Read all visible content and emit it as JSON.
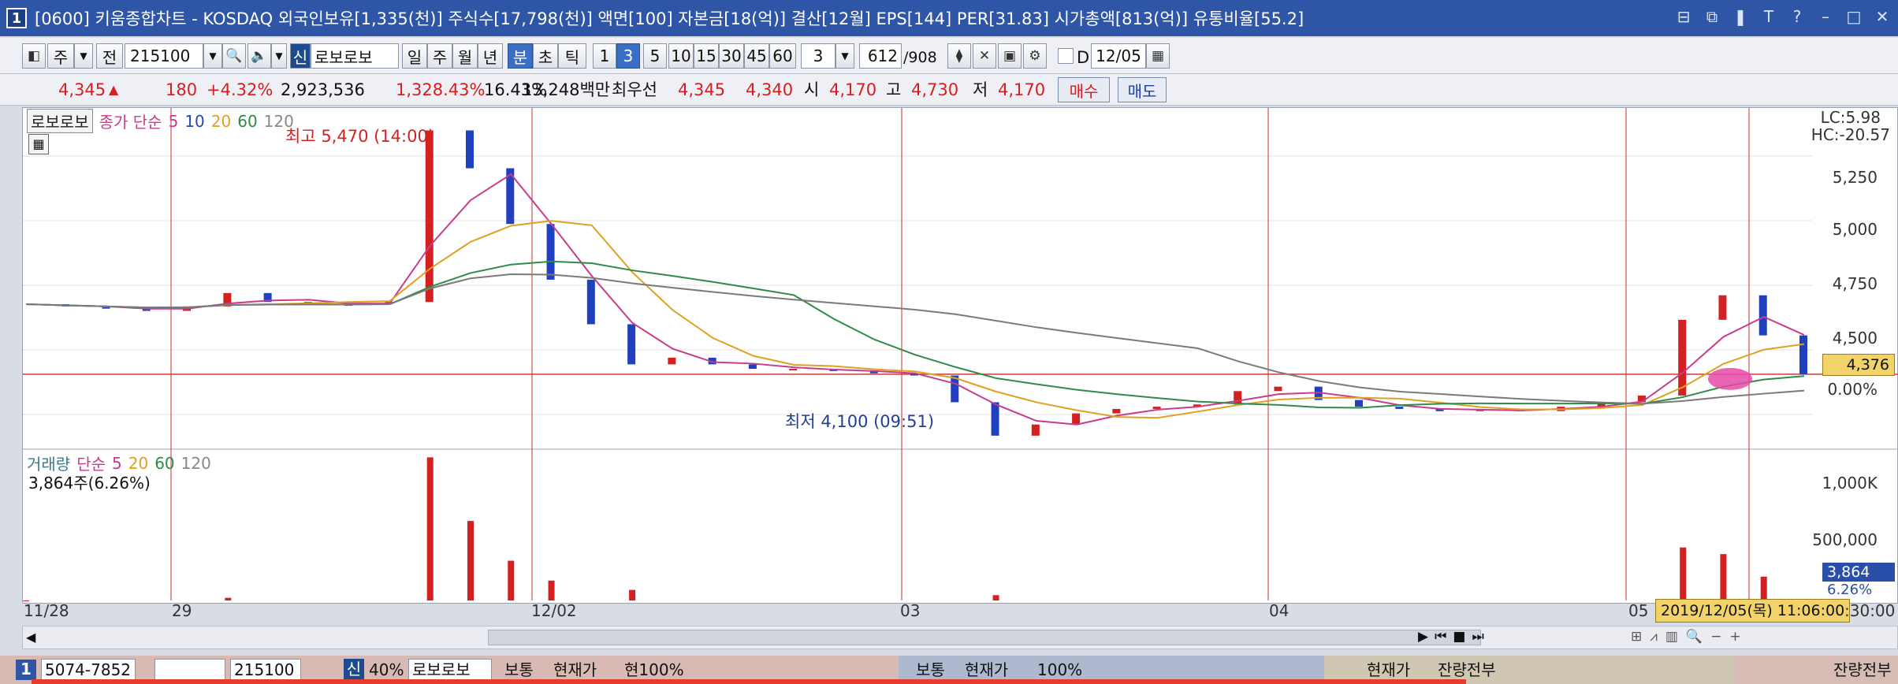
{
  "window": {
    "number": "1",
    "title": "[0600] 키움종합차트 - KOSDAQ 외국인보유[1,335(천)] 주식수[17,798(천)] 액면[100] 자본금[18(억)] 결산[12월] EPS[144] PER[31.83] 시가총액[813(억)] 유통비율[55.2]",
    "buttons": [
      "⊟",
      "⧉",
      "❚",
      "T",
      "?",
      "–",
      "□",
      "✕"
    ]
  },
  "toolbar": {
    "period_type": "주",
    "prev_label": "전",
    "code": "215100",
    "market_tag": "신",
    "stock_name": "로보로보",
    "periods": [
      "일",
      "주",
      "월",
      "년",
      "분",
      "초",
      "틱"
    ],
    "minutes": [
      "1",
      "3",
      "5",
      "10",
      "15",
      "30",
      "45",
      "60"
    ],
    "selected_minute": "3",
    "count_value": "3",
    "data_count": "612",
    "data_total": "/908",
    "date_checkbox_label": "D",
    "date_value": "12/05"
  },
  "quote": {
    "price": "4,345",
    "change": "180",
    "change_pct": "+4.32%",
    "volume": "2,923,536",
    "volume_ratio": "1,328.43%",
    "turnover": "16.43%",
    "amount": "13,248백만",
    "best_label": "최우선",
    "best_ask": "4,345",
    "best_bid": "4,340",
    "open_label": "시",
    "open": "4,170",
    "high_label": "고",
    "high": "4,730",
    "low_label": "저",
    "low": "4,170",
    "buy_label": "매수",
    "sell_label": "매도"
  },
  "price_panel": {
    "name": "로보로보",
    "ma_label": "종가 단순",
    "ma_periods": [
      "5",
      "10",
      "20",
      "60",
      "120"
    ],
    "high_annotation": "최고 5,470 (14:00)",
    "low_annotation": "최저 4,100 (09:51)",
    "lc": "LC:5.98",
    "hc": "HC:-20.57",
    "y_labels": [
      "5,250",
      "5,000",
      "4,750",
      "4,500",
      "0.00%"
    ],
    "current_price_tag": "4,376"
  },
  "volume_panel": {
    "label": "거래량",
    "ma_label": "단순",
    "ma_periods": [
      "5",
      "20",
      "60",
      "120"
    ],
    "info": "3,864주(6.26%)",
    "y_labels": [
      "1,000K",
      "500,000"
    ],
    "current_volume": "3,864",
    "current_volume_pct": "6.26%"
  },
  "x_axis": {
    "labels": [
      "11/28",
      "29",
      "12/02",
      "03",
      "04",
      "05"
    ],
    "cursor_time": "2019/12/05(목) 11:06:00",
    "end_label": ":30:00"
  },
  "bottom_bar": {
    "window_number": "1",
    "account": "5074-7852",
    "code": "215100",
    "market_tag": "신",
    "margin": "40%",
    "stock_name": "로보로보",
    "order_type_1": "보통",
    "price_type_1": "현재가",
    "qty_1": "현100%",
    "order_type_2": "보통",
    "price_type_2": "현재가",
    "qty_2": "100%",
    "price_type_3": "현재가",
    "qty_3": "잔량전부",
    "qty_4": "잔량전부"
  },
  "chart_data": {
    "type": "candlestick",
    "timeframe": "3분",
    "price_series": [
      {
        "t": 0,
        "c": 4690
      },
      {
        "t": 1,
        "c": 4680
      },
      {
        "t": 2,
        "c": 4670
      },
      {
        "t": 3,
        "c": 4660
      },
      {
        "t": 4,
        "c": 4680
      },
      {
        "t": 5,
        "c": 4740
      },
      {
        "t": 6,
        "c": 4700
      },
      {
        "t": 7,
        "c": 4690
      },
      {
        "t": 8,
        "c": 4690
      },
      {
        "t": 9,
        "c": 4700
      },
      {
        "t": 10,
        "c": 5470
      },
      {
        "t": 11,
        "c": 5300
      },
      {
        "t": 12,
        "c": 5050
      },
      {
        "t": 13,
        "c": 4800
      },
      {
        "t": 14,
        "c": 4600
      },
      {
        "t": 15,
        "c": 4420
      },
      {
        "t": 16,
        "c": 4450
      },
      {
        "t": 17,
        "c": 4420
      },
      {
        "t": 18,
        "c": 4400
      },
      {
        "t": 19,
        "c": 4400
      },
      {
        "t": 20,
        "c": 4390
      },
      {
        "t": 21,
        "c": 4380
      },
      {
        "t": 22,
        "c": 4370
      },
      {
        "t": 23,
        "c": 4250
      },
      {
        "t": 24,
        "c": 4100
      },
      {
        "t": 25,
        "c": 4150
      },
      {
        "t": 26,
        "c": 4200
      },
      {
        "t": 27,
        "c": 4220
      },
      {
        "t": 28,
        "c": 4230
      },
      {
        "t": 29,
        "c": 4240
      },
      {
        "t": 30,
        "c": 4300
      },
      {
        "t": 31,
        "c": 4320
      },
      {
        "t": 32,
        "c": 4260
      },
      {
        "t": 33,
        "c": 4230
      },
      {
        "t": 34,
        "c": 4220
      },
      {
        "t": 35,
        "c": 4210
      },
      {
        "t": 36,
        "c": 4220
      },
      {
        "t": 37,
        "c": 4210
      },
      {
        "t": 38,
        "c": 4230
      },
      {
        "t": 39,
        "c": 4250
      },
      {
        "t": 40,
        "c": 4280
      },
      {
        "t": 41,
        "c": 4620
      },
      {
        "t": 42,
        "c": 4730
      },
      {
        "t": 43,
        "c": 4550
      },
      {
        "t": 44,
        "c": 4376
      }
    ],
    "volume_series": [
      {
        "t": 0,
        "v": 0
      },
      {
        "t": 5,
        "v": 20000
      },
      {
        "t": 10,
        "v": 1080000
      },
      {
        "t": 11,
        "v": 600000
      },
      {
        "t": 12,
        "v": 300000
      },
      {
        "t": 13,
        "v": 150000
      },
      {
        "t": 15,
        "v": 80000
      },
      {
        "t": 24,
        "v": 40000
      },
      {
        "t": 41,
        "v": 400000
      },
      {
        "t": 42,
        "v": 350000
      },
      {
        "t": 43,
        "v": 180000
      },
      {
        "t": 44,
        "v": 3864
      }
    ],
    "y_range": [
      4100,
      5470
    ],
    "grid": true
  }
}
